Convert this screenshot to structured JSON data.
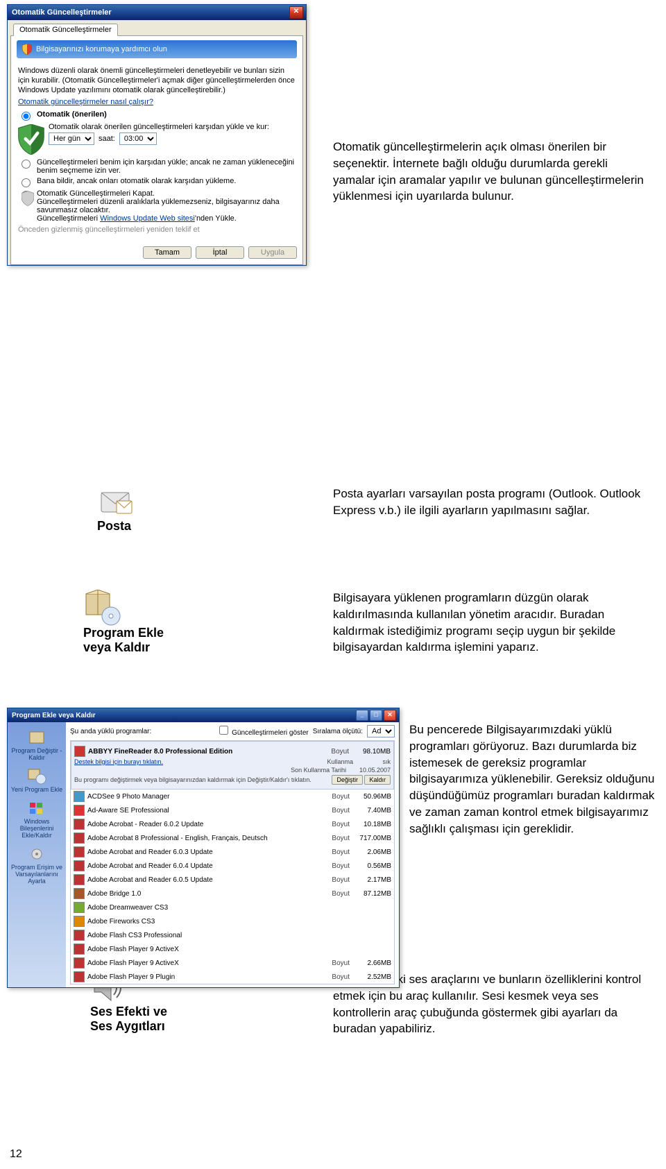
{
  "dialog": {
    "title": "Otomatik Güncelleştirmeler",
    "tab_label": "Otomatik Güncelleştirmeler",
    "banner": "Bilgisayarınızı korumaya yardımcı olun",
    "intro1": "Windows düzenli olarak önemli güncelleştirmeleri denetleyebilir ve bunları sizin için kurabilir. (Otomatik Güncelleştirmeler'i açmak diğer güncelleştirmelerden önce Windows Update yazılımını otomatik olarak güncelleştirebilir.)",
    "howlink": "Otomatik güncelleştirmeler nasıl çalışır?",
    "opt1_label": "Otomatik (önerilen)",
    "opt1_desc": "Otomatik olarak önerilen güncelleştirmeleri karşıdan yükle ve kur:",
    "every": "Her gün",
    "saat_label": "saat:",
    "saat_value": "03:00",
    "opt2": "Güncelleştirmeleri benim için karşıdan yükle; ancak ne zaman yükleneceğini benim seçmeme izin ver.",
    "opt3": "Bana bildir, ancak onları otomatik olarak karşıdan yükleme.",
    "opt4": "Otomatik Güncelleştirmeleri Kapat.",
    "opt4_desc1": "Güncelleştirmeleri düzenli aralıklarla yüklemezseniz, bilgisayarınız daha savunmasız olacaktır.",
    "opt4_desc2a": "Güncelleştirmeleri ",
    "opt4_desc2_link": "Windows Update Web sitesi",
    "opt4_desc2b": "'nden Yükle.",
    "prev_offer": "Önceden gizlenmiş güncelleştirmeleri yeniden teklif et",
    "btn_ok": "Tamam",
    "btn_cancel": "İptal",
    "btn_apply": "Uygula"
  },
  "para": {
    "p1": "Otomatik güncelleştirmelerin açık olması önerilen bir seçenektir. İnternete bağlı olduğu durumlarda gerekli yamalar için aramalar yapılır ve bulunan güncelleştirmelerin yüklenmesi için uyarılarda bulunur.",
    "p2": "Posta ayarları varsayılan posta programı (Outlook. Outlook Express v.b.) ile ilgili ayarların yapılmasını sağlar.",
    "p3": "Bilgisayara yüklenen programların düzgün olarak kaldırılmasında kullanılan yönetim aracıdır. Buradan kaldırmak istediğimiz programı seçip uygun bir şekilde bilgisayardan kaldırma işlemini yaparız.",
    "p4": "Bu pencerede Bilgisayarımızdaki yüklü programları görüyoruz. Bazı durumlarda biz istemesek de gereksiz programlar bilgisayarımıza yüklenebilir. Gereksiz olduğunu düşündüğümüz programları buradan kaldırmak ve zaman zaman kontrol etmek bilgisayarımız sağlıklı çalışması için gereklidir.",
    "p5": "Bilgisayardaki ses araçlarını ve bunların özelliklerini kontrol etmek için bu araç kullanılır. Sesi kesmek veya ses kontrollerin araç çubuğunda göstermek gibi ayarları da buradan yapabiliriz."
  },
  "labels": {
    "posta": "Posta",
    "addremove_l1": "Program Ekle",
    "addremove_l2": "veya Kaldır",
    "sound_l1": "Ses Efekti ve",
    "sound_l2": "Ses Aygıtları"
  },
  "arp": {
    "title": "Program Ekle veya Kaldır",
    "toprow_left": "Şu anda yüklü programlar:",
    "toprow_check": "Güncelleştirmeleri göster",
    "sort_label": "Sıralama ölçütü:",
    "sort_value": "Ad",
    "side": {
      "s1": "Program Değiştir - Kaldır",
      "s2": "Yeni Program Ekle",
      "s3": "Windows Bileşenlerini Ekle/Kaldır",
      "s4": "Program Erişim ve Varsayılanlarını Ayarla"
    },
    "sel": {
      "name": "ABBYY FineReader 8.0 Professional Edition",
      "support": "Destek bilgisi için burayı tıklatın.",
      "size_lbl": "Boyut",
      "size_val": "98.10MB",
      "use_lbl": "Kullanma",
      "use_val": "sık",
      "last_lbl": "Son Kullanma Tarihi",
      "last_val": "10.05.2007",
      "desc": "Bu programı değiştirmek veya bilgisayarınızdan kaldırmak için Değiştir/Kaldır'ı tıklatın.",
      "btn_change": "Değiştir",
      "btn_remove": "Kaldır"
    },
    "items": [
      {
        "name": "ACDSee 9 Photo Manager",
        "size": "50.96MB"
      },
      {
        "name": "Ad-Aware SE Professional",
        "size": "7.40MB"
      },
      {
        "name": "Adobe Acrobat - Reader 6.0.2 Update",
        "size": "10.18MB"
      },
      {
        "name": "Adobe Acrobat 8 Professional - English, Français, Deutsch",
        "size": "717.00MB"
      },
      {
        "name": "Adobe Acrobat and Reader 6.0.3 Update",
        "size": "2.06MB"
      },
      {
        "name": "Adobe Acrobat and Reader 6.0.4 Update",
        "size": "0.56MB"
      },
      {
        "name": "Adobe Acrobat and Reader 6.0.5 Update",
        "size": "2.17MB"
      },
      {
        "name": "Adobe Bridge 1.0",
        "size": "87.12MB"
      },
      {
        "name": "Adobe Dreamweaver CS3",
        "size": ""
      },
      {
        "name": "Adobe Fireworks CS3",
        "size": ""
      },
      {
        "name": "Adobe Flash CS3 Professional",
        "size": ""
      },
      {
        "name": "Adobe Flash Player 9 ActiveX",
        "size": ""
      },
      {
        "name": "Adobe Flash Player 9 ActiveX",
        "size": "2.66MB"
      },
      {
        "name": "Adobe Flash Player 9 Plugin",
        "size": "2.52MB"
      }
    ],
    "size_lbl": "Boyut"
  },
  "pagenum": "12"
}
